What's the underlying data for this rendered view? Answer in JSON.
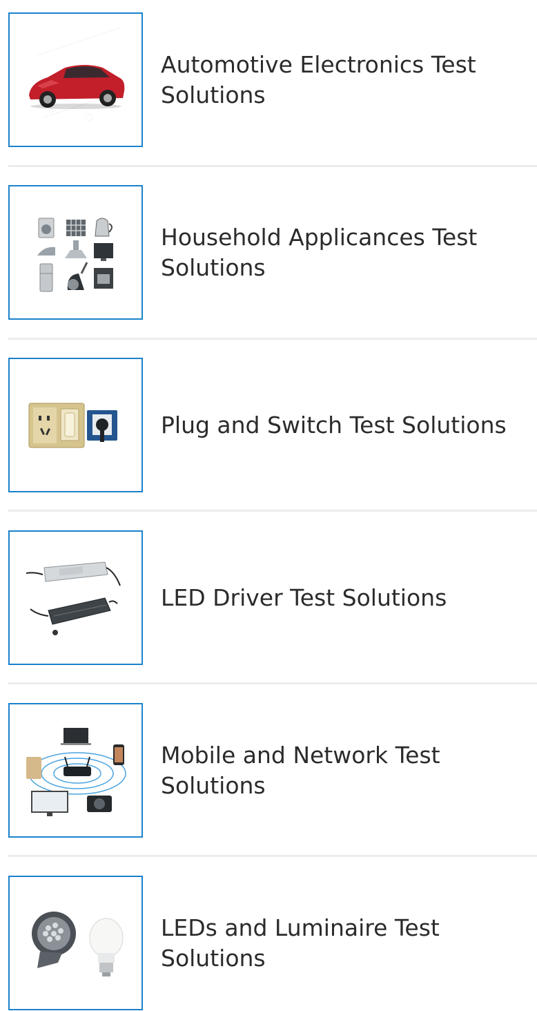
{
  "solutions": [
    {
      "title": "Automotive Electronics Test Solutions",
      "icon": "car-icon"
    },
    {
      "title": "Household Applicances Test Solutions",
      "icon": "household-appliances-icon"
    },
    {
      "title": "Plug and Switch Test Solutions",
      "icon": "plug-switch-icon"
    },
    {
      "title": "LED Driver Test Solutions",
      "icon": "led-driver-icon"
    },
    {
      "title": "Mobile and Network Test Solutions",
      "icon": "mobile-network-icon"
    },
    {
      "title": "LEDs and Luminaire Test Solutions",
      "icon": "luminaire-icon"
    }
  ],
  "colors": {
    "thumb_border": "#1a82cc",
    "divider": "#ececec",
    "text": "#2b2b2b"
  }
}
